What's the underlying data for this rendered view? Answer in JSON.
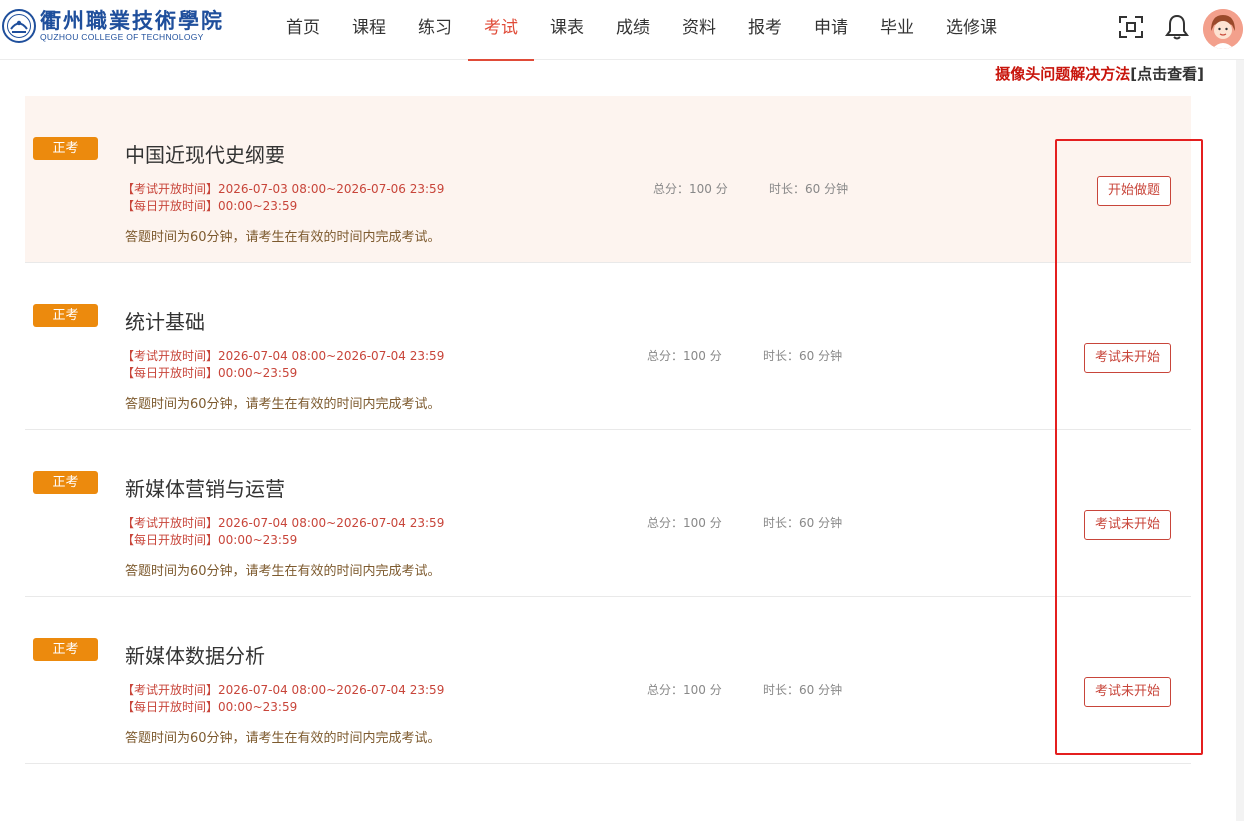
{
  "header": {
    "logo_cn": "衢州職業技術學院",
    "logo_en": "QUZHOU COLLEGE OF TECHNOLOGY",
    "nav": [
      {
        "label": "首页"
      },
      {
        "label": "课程"
      },
      {
        "label": "练习"
      },
      {
        "label": "考试",
        "active": true
      },
      {
        "label": "课表"
      },
      {
        "label": "成绩"
      },
      {
        "label": "资料"
      },
      {
        "label": "报考"
      },
      {
        "label": "申请"
      },
      {
        "label": "毕业"
      },
      {
        "label": "选修课"
      }
    ],
    "icons": [
      "scan-icon",
      "bell-icon"
    ]
  },
  "camera_help": {
    "text": "摄像头问题解决方法",
    "link": "[点击查看]"
  },
  "exams": [
    {
      "badge": "正考",
      "title": "中国近现代史纲要",
      "open_time": "【考试开放时间】2026-07-03 08:00~2026-07-06 23:59",
      "daily_time": "【每日开放时间】00:00~23:59",
      "total_score": "总分：100 分",
      "duration": "时长：60 分钟",
      "desc": "答题时间为60分钟，请考生在有效的时间内完成考试。",
      "button": "开始做题"
    },
    {
      "badge": "正考",
      "title": "统计基础",
      "open_time": "【考试开放时间】2026-07-04 08:00~2026-07-04 23:59",
      "daily_time": "【每日开放时间】00:00~23:59",
      "total_score": "总分：100 分",
      "duration": "时长：60 分钟",
      "desc": "答题时间为60分钟，请考生在有效的时间内完成考试。",
      "button": "考试未开始"
    },
    {
      "badge": "正考",
      "title": "新媒体营销与运营",
      "open_time": "【考试开放时间】2026-07-04 08:00~2026-07-04 23:59",
      "daily_time": "【每日开放时间】00:00~23:59",
      "total_score": "总分：100 分",
      "duration": "时长：60 分钟",
      "desc": "答题时间为60分钟，请考生在有效的时间内完成考试。",
      "button": "考试未开始"
    },
    {
      "badge": "正考",
      "title": "新媒体数据分析",
      "open_time": "【考试开放时间】2026-07-04 08:00~2026-07-04 23:59",
      "daily_time": "【每日开放时间】00:00~23:59",
      "total_score": "总分：100 分",
      "duration": "时长：60 分钟",
      "desc": "答题时间为60分钟，请考生在有效的时间内完成考试。",
      "button": "考试未开始"
    }
  ],
  "colors": {
    "accent": "#e04b38",
    "badge": "#ec8a0d",
    "highlight_row": "#fdf4ef",
    "annotation_box": "#e41f1f"
  }
}
